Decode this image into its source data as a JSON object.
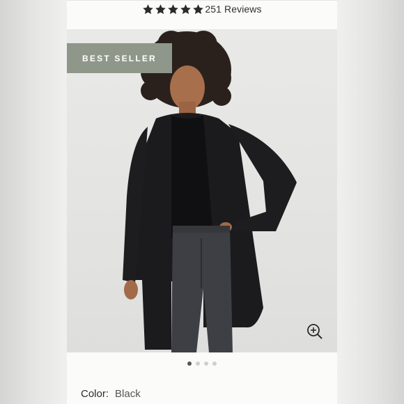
{
  "rating": {
    "stars": 5,
    "reviews_text": "251 Reviews"
  },
  "product": {
    "badge": "BEST SELLER",
    "color_label": "Color:",
    "color_value": "Black"
  },
  "carousel": {
    "total": 4,
    "active_index": 0
  },
  "icons": {
    "star": "star-icon",
    "zoom": "zoom-in-icon"
  },
  "colors": {
    "badge_bg": "#8f978a",
    "star": "#2b2b2b",
    "dot_active": "#555555",
    "dot_inactive": "#cfcfcc"
  }
}
